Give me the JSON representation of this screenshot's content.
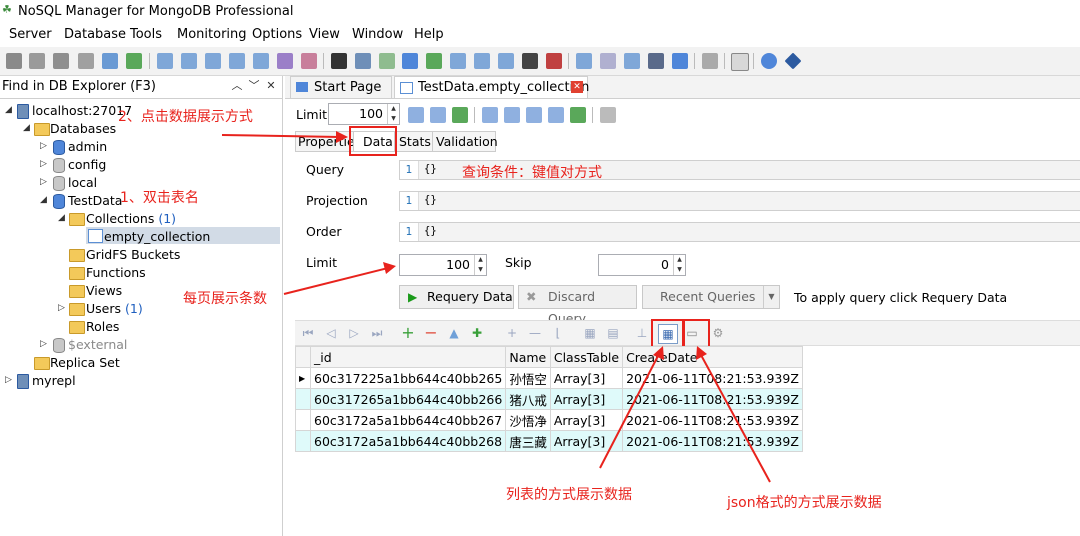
{
  "window": {
    "title": "NoSQL Manager for MongoDB Professional"
  },
  "menu": [
    "Server",
    "Database",
    "Tools",
    "Monitoring",
    "Options",
    "View",
    "Window",
    "Help"
  ],
  "explorer": {
    "find_label": "Find in DB Explorer (F3)",
    "tree": {
      "localhost": "localhost:27017",
      "databases": "Databases",
      "admin": "admin",
      "config": "config",
      "local": "local",
      "testdata": "TestData",
      "collections": "Collections",
      "collections_count": "(1)",
      "empty_collection": "empty_collection",
      "gridfs": "GridFS Buckets",
      "functions": "Functions",
      "views": "Views",
      "users": "Users",
      "users_count": "(1)",
      "roles": "Roles",
      "external": "$external",
      "replica_set": "Replica Set",
      "myrepl": "myrepl"
    }
  },
  "tabs": {
    "start_page": "Start Page",
    "collection": "TestData.empty_collection"
  },
  "subbar": {
    "limit_label": "Limit",
    "limit_value": "100"
  },
  "inner_tabs": [
    "Properties",
    "Data",
    "Stats",
    "Validation"
  ],
  "query_form": {
    "query_label": "Query",
    "query_value": "{}",
    "projection_label": "Projection",
    "projection_value": "{}",
    "order_label": "Order",
    "order_value": "{}",
    "line_number": "1",
    "limit_label": "Limit",
    "limit_value": "100",
    "skip_label": "Skip",
    "skip_value": "0",
    "requery_button": "Requery Data",
    "discard_button": "Discard Query",
    "recent_button": "Recent Queries",
    "hint": "To apply query click Requery Data"
  },
  "grid": {
    "columns": [
      "_id",
      "Name",
      "ClassTable",
      "CreateDate"
    ],
    "rows": [
      {
        "id": "60c317225a1bb644c40bb265",
        "name": "孙悟空",
        "class": "Array[3]",
        "date": "2021-06-11T08:21:53.939Z"
      },
      {
        "id": "60c317265a1bb644c40bb266",
        "name": "猪八戒",
        "class": "Array[3]",
        "date": "2021-06-11T08:21:53.939Z"
      },
      {
        "id": "60c3172a5a1bb644c40bb267",
        "name": "沙悟净",
        "class": "Array[3]",
        "date": "2021-06-11T08:21:53.939Z"
      },
      {
        "id": "60c3172a5a1bb644c40bb268",
        "name": "唐三藏",
        "class": "Array[3]",
        "date": "2021-06-11T08:21:53.939Z"
      }
    ]
  },
  "annotations": {
    "step2": "2、点击数据展示方式",
    "step1": "1、双击表名",
    "query_note": "查询条件：键值对方式",
    "per_page": "每页展示条数",
    "list_view": "列表的方式展示数据",
    "json_view": "json格式的方式展示数据"
  },
  "colors": {
    "annotation_red": "#e8231d",
    "row_alt": "#dffafa",
    "selection": "#d2dbe6"
  }
}
